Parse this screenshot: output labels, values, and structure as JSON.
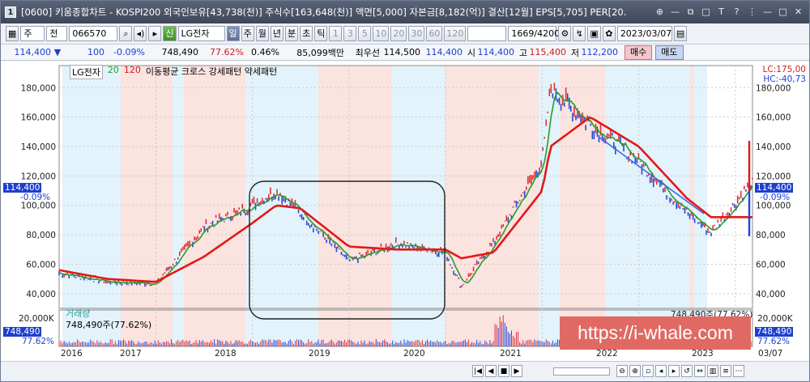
{
  "window": {
    "number": "1",
    "title": "[0600] 키움종합차트 - KOSPI200 외국인보유[43,738(천)] 주식수[163,648(천)] 액면[5,000] 자본금[8,182(억)] 결산[12월] EPS[5,705] PER[20.",
    "controls": [
      "⊕",
      "—",
      "⧉",
      "□",
      "T",
      "?",
      "⋮",
      "—",
      "□",
      "✕"
    ]
  },
  "toolbar": {
    "market": "주",
    "mode": "전",
    "code": "066570",
    "sin_label": "신",
    "name": "LG전자",
    "periods": [
      "일",
      "주",
      "월",
      "년",
      "분",
      "초",
      "틱"
    ],
    "minutes": [
      "1",
      "3",
      "5",
      "10",
      "20",
      "30",
      "60",
      "120"
    ],
    "count": "1669",
    "total": "/4200",
    "date": "2023/03/07"
  },
  "quote": {
    "price": "114,400",
    "arrow": "▼",
    "change": "100",
    "change_pct": "-0.09%",
    "volume": "748,490",
    "vol_ratio": "77.62%",
    "turnover": "0.46%",
    "amount": "85,099백만",
    "best_bid_label": "최우선",
    "best_bid": "114,500",
    "best_ask": "114,400",
    "open_label": "시",
    "open": "114,400",
    "high_label": "고",
    "high": "115,400",
    "low_label": "저",
    "low": "112,200",
    "buy_label": "매수",
    "sell_label": "매도"
  },
  "chart_legend": {
    "name": "LG전자",
    "ma20": "20",
    "ma120": "120",
    "text": "이동평균 크로스 강세패턴 약세패턴",
    "lc": "LC:175,00",
    "hc": "HC:-40,73"
  },
  "price_axis": {
    "ticks": [
      "180,000",
      "160,000",
      "140,000",
      "120,000",
      "100,000",
      "80,000",
      "60,000",
      "40,000"
    ],
    "last_price": "114,400",
    "last_pct": "-0.09%"
  },
  "volume_panel": {
    "name": "거래량",
    "value": "748,490주(77.62%)",
    "right_label": "748,490주(77.62%)",
    "ticks": [
      "20,000K"
    ],
    "last_value": "748,490",
    "last_pct": "77.62%"
  },
  "x_axis": [
    "2016",
    "2017",
    "2018",
    "2019",
    "2020",
    "2021",
    "2022",
    "2023",
    "03/07"
  ],
  "watermark": "https://i-whale.com",
  "chart_data": {
    "type": "line",
    "x": [
      "2016-01",
      "2016-07",
      "2017-01",
      "2017-07",
      "2018-01",
      "2018-04",
      "2018-07",
      "2019-01",
      "2019-07",
      "2020-01",
      "2020-03",
      "2020-07",
      "2021-01",
      "2021-02",
      "2021-07",
      "2022-01",
      "2022-07",
      "2022-10",
      "2023-03"
    ],
    "series": [
      {
        "name": "LG전자",
        "values": [
          54000,
          48000,
          47000,
          85000,
          100000,
          110000,
          95000,
          62000,
          74000,
          68000,
          45000,
          75000,
          130000,
          180000,
          155000,
          130000,
          95000,
          82000,
          114400
        ]
      },
      {
        "name": "120",
        "values": [
          56000,
          50000,
          48000,
          65000,
          88000,
          100000,
          98000,
          72000,
          70000,
          70000,
          64000,
          68000,
          110000,
          140000,
          160000,
          140000,
          105000,
          92000,
          92000
        ]
      }
    ],
    "ylim": [
      30000,
      195000
    ],
    "grid": true,
    "legend": "top-left"
  }
}
